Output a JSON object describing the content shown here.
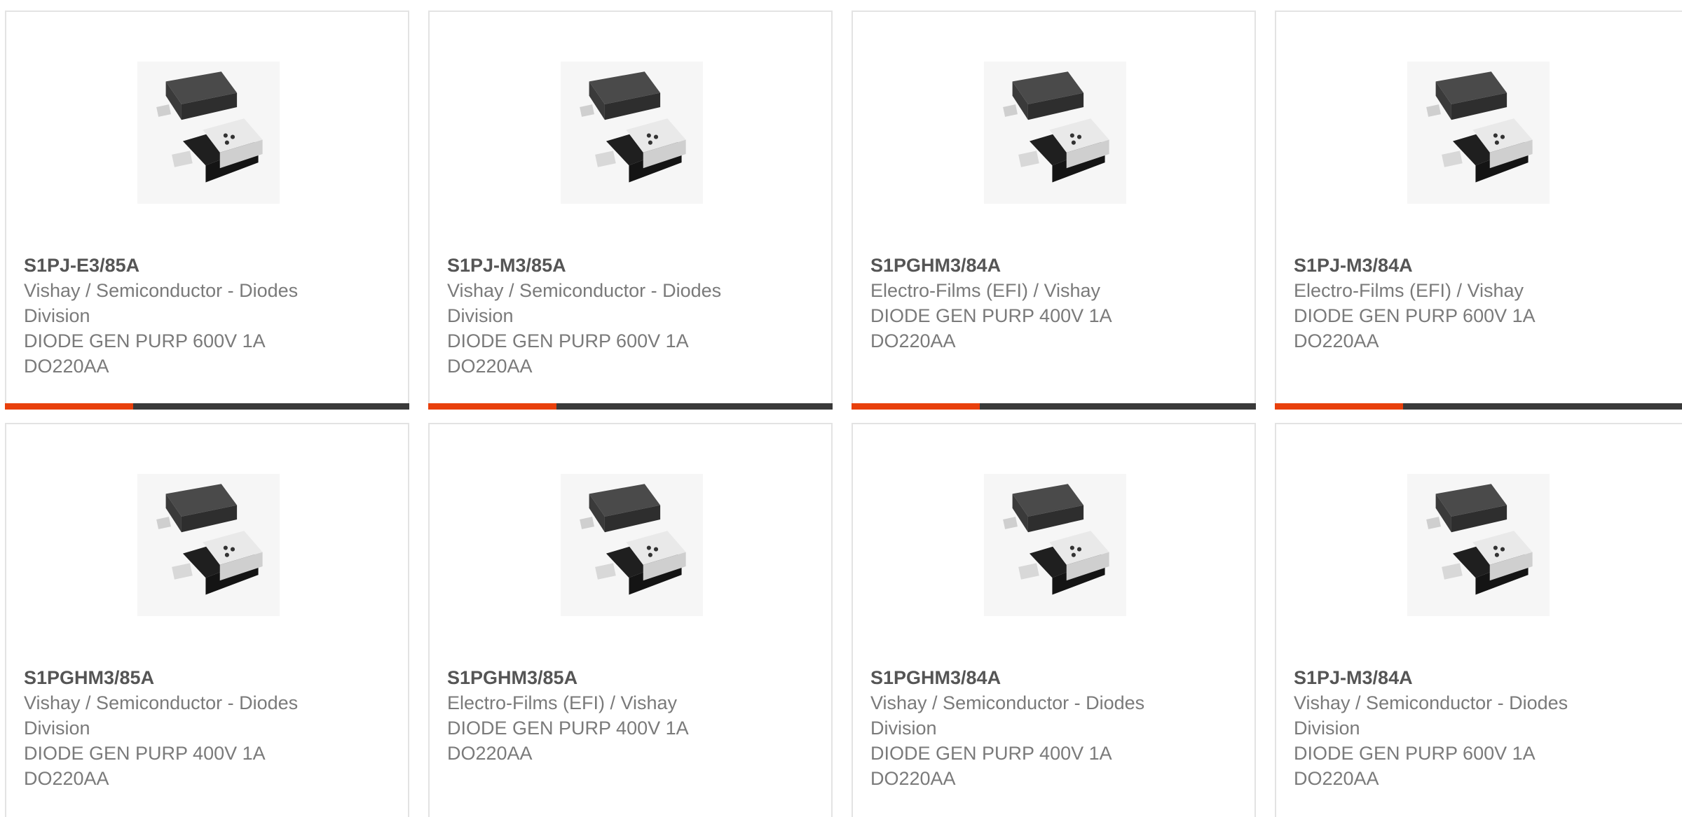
{
  "colors": {
    "accent": "#e8400c",
    "bar": "#3a3a3a"
  },
  "products": [
    {
      "part": "S1PJ-E3/85A",
      "manufacturer": "Vishay / Semiconductor - Diodes Division",
      "description": "DIODE GEN PURP 600V 1A DO220AA"
    },
    {
      "part": "S1PJ-M3/85A",
      "manufacturer": "Vishay / Semiconductor - Diodes Division",
      "description": "DIODE GEN PURP 600V 1A DO220AA"
    },
    {
      "part": "S1PGHM3/84A",
      "manufacturer": "Electro-Films (EFI) / Vishay",
      "description": "DIODE GEN PURP 400V 1A DO220AA"
    },
    {
      "part": "S1PJ-M3/84A",
      "manufacturer": "Electro-Films (EFI) / Vishay",
      "description": "DIODE GEN PURP 600V 1A DO220AA"
    },
    {
      "part": "S1PGHM3/85A",
      "manufacturer": "Vishay / Semiconductor - Diodes Division",
      "description": "DIODE GEN PURP 400V 1A DO220AA"
    },
    {
      "part": "S1PGHM3/85A",
      "manufacturer": "Electro-Films (EFI) / Vishay",
      "description": "DIODE GEN PURP 400V 1A DO220AA"
    },
    {
      "part": "S1PGHM3/84A",
      "manufacturer": "Vishay / Semiconductor - Diodes Division",
      "description": "DIODE GEN PURP 400V 1A DO220AA"
    },
    {
      "part": "S1PJ-M3/84A",
      "manufacturer": "Vishay / Semiconductor - Diodes Division",
      "description": "DIODE GEN PURP 600V 1A DO220AA"
    }
  ],
  "image_icon": "diode-package-image"
}
